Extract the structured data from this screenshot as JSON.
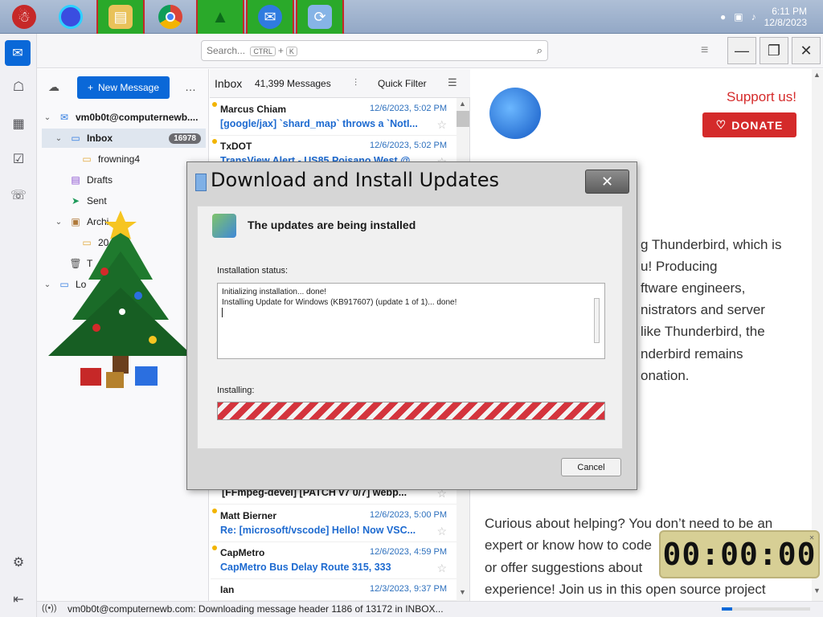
{
  "taskbar": {
    "clock_time": "6:11 PM",
    "clock_date": "12/8/2023"
  },
  "toolbar": {
    "search_placeholder": "Search...",
    "search_key1": "CTRL",
    "search_plus": "+",
    "search_key2": "K"
  },
  "folders": {
    "new_message": "New Message",
    "account": "vm0b0t@computernewb....",
    "inbox": "Inbox",
    "inbox_count": "16978",
    "frowning": "frowning4",
    "drafts": "Drafts",
    "sent": "Sent",
    "archive": "Archi",
    "archive_sub": "20",
    "trash": "T",
    "local": "Lo"
  },
  "list": {
    "title": "Inbox",
    "count": "41,399 Messages",
    "quick_filter": "Quick Filter",
    "messages": [
      {
        "from": "Marcus Chiam",
        "date": "12/6/2023, 5:02 PM",
        "subject": "[google/jax] `shard_map` throws a `NotI..."
      },
      {
        "from": "TxDOT",
        "date": "12/6/2023, 5:02 PM",
        "subject": "TransView Alert - US85 Poisano West @..."
      },
      {
        "from": "",
        "date": "",
        "subject": "[FFmpeg-devel] [PATCH v7 0/7] webp..."
      },
      {
        "from": "Matt Bierner",
        "date": "12/6/2023, 5:00 PM",
        "subject": "Re: [microsoft/vscode] Hello! Now VSC..."
      },
      {
        "from": "CapMetro",
        "date": "12/6/2023, 4:59 PM",
        "subject": "CapMetro Bus Delay Route 315, 333"
      },
      {
        "from": "Ian",
        "date": "12/3/2023, 9:37 PM",
        "subject": ""
      }
    ]
  },
  "reading": {
    "support": "Support us!",
    "donate": "DONATE",
    "lines": [
      "g Thunderbird, which is",
      "u! Producing",
      "ftware engineers,",
      "nistrators and server",
      "like Thunderbird, the",
      "nderbird remains",
      "onation."
    ],
    "bottom_lines": [
      "Curious about helping? You don’t need to be an",
      "expert or know how to code",
      "or offer suggestions about",
      "experience! Join us in this open source project"
    ]
  },
  "status": {
    "text": "vm0b0t@computernewb.com: Downloading message header 1186 of 13172 in INBOX..."
  },
  "dialog": {
    "title": "Download and Install Updates",
    "heading": "The updates are being installed",
    "status_label": "Installation status:",
    "log_line1": "Initializing installation... done!",
    "log_line2": "Installing Update for Windows (KB917607) (update 1 of 1)... done!",
    "installing_label": "Installing:",
    "cancel": "Cancel"
  },
  "timer": {
    "value": "00:00:00"
  }
}
